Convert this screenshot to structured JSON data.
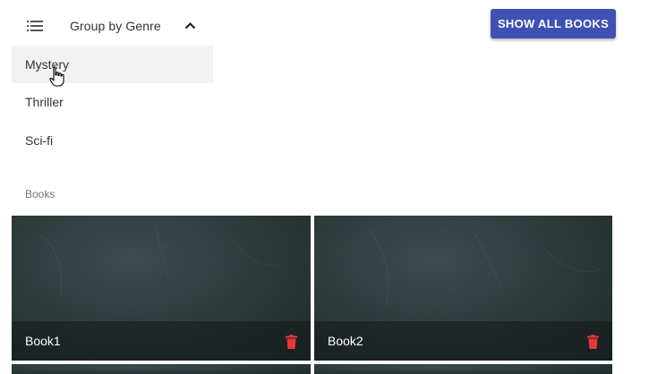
{
  "group_menu": {
    "header_label": "Group by Genre",
    "items": [
      {
        "label": "Mystery"
      },
      {
        "label": "Thriller"
      },
      {
        "label": "Sci-fi"
      }
    ]
  },
  "toolbar": {
    "show_all_label": "SHOW ALL BOOKS"
  },
  "books_section": {
    "subheader": "Books",
    "books": [
      {
        "title": "Book1"
      },
      {
        "title": "Book2"
      }
    ]
  },
  "colors": {
    "primary": "#3f51b5",
    "delete": "#e53935",
    "active_item_bg": "#f2f2f2"
  }
}
